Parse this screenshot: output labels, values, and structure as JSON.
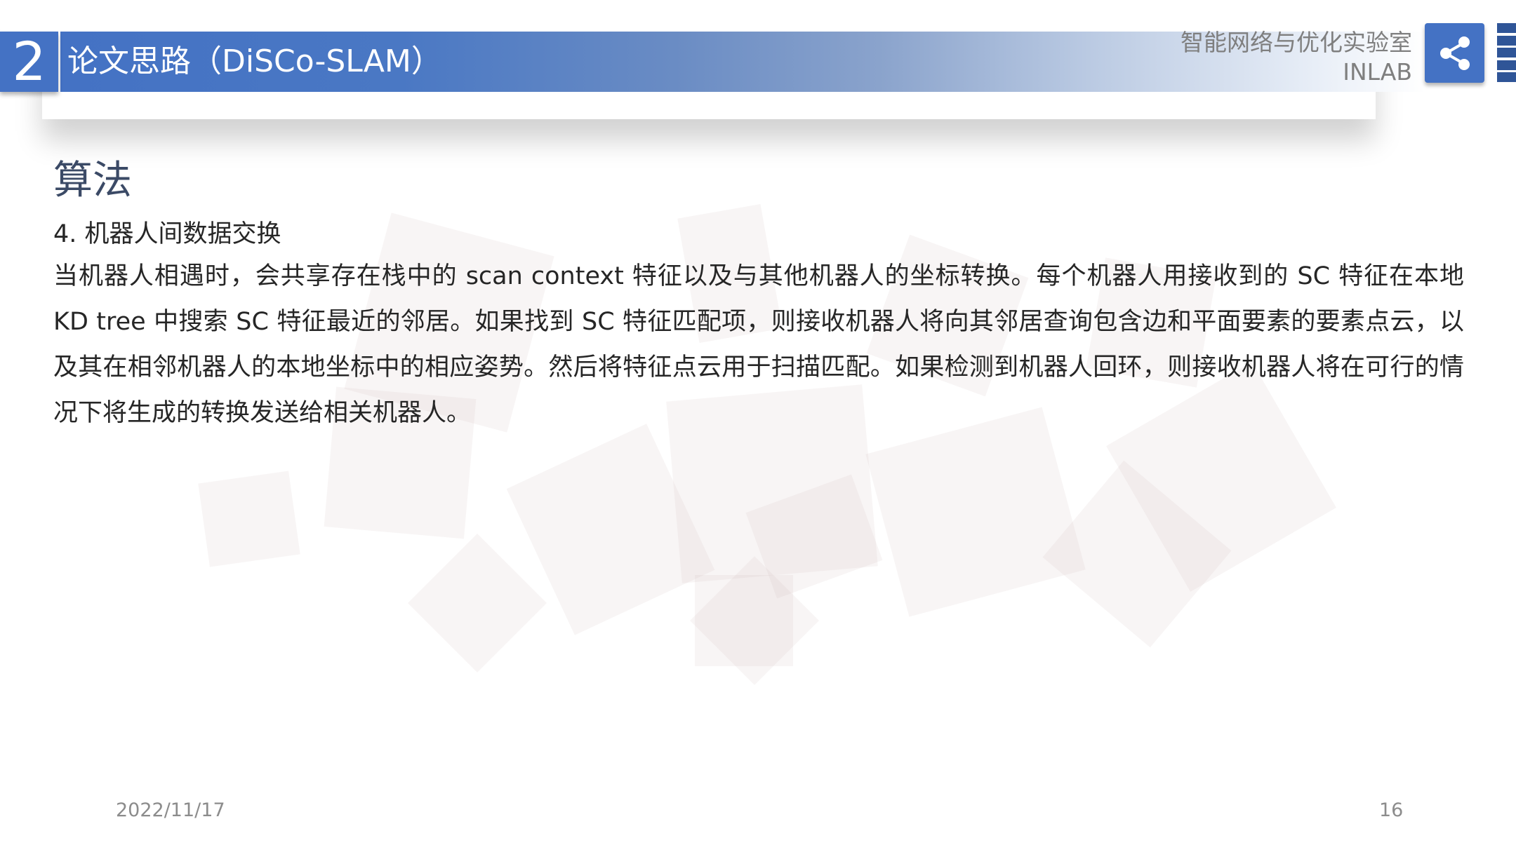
{
  "header": {
    "section_number": "2",
    "title": "论文思路（DiSCo-SLAM）",
    "lab_name": "智能网络与优化实验室",
    "lab_abbr": "INLAB",
    "share_icon": "share-icon"
  },
  "content": {
    "heading": "算法",
    "subheading": "4. 机器人间数据交换",
    "paragraph": "当机器人相遇时，会共享存在栈中的 scan context 特征以及与其他机器人的坐标转换。每个机器人用接收到的 SC 特征在本地 KD tree 中搜索 SC 特征最近的邻居。如果找到 SC 特征匹配项，则接收机器人将向其邻居查询包含边和平面要素的要素点云，以及其在相邻机器人的本地坐标中的相应姿势。然后将特征点云用于扫描匹配。如果检测到机器人回环，则接收机器人将在可行的情况下将生成的转换发送给相关机器人。"
  },
  "footer": {
    "date": "2022/11/17",
    "page_number": "16"
  },
  "colors": {
    "accent": "#4472c4",
    "heading": "#3b4a66"
  }
}
